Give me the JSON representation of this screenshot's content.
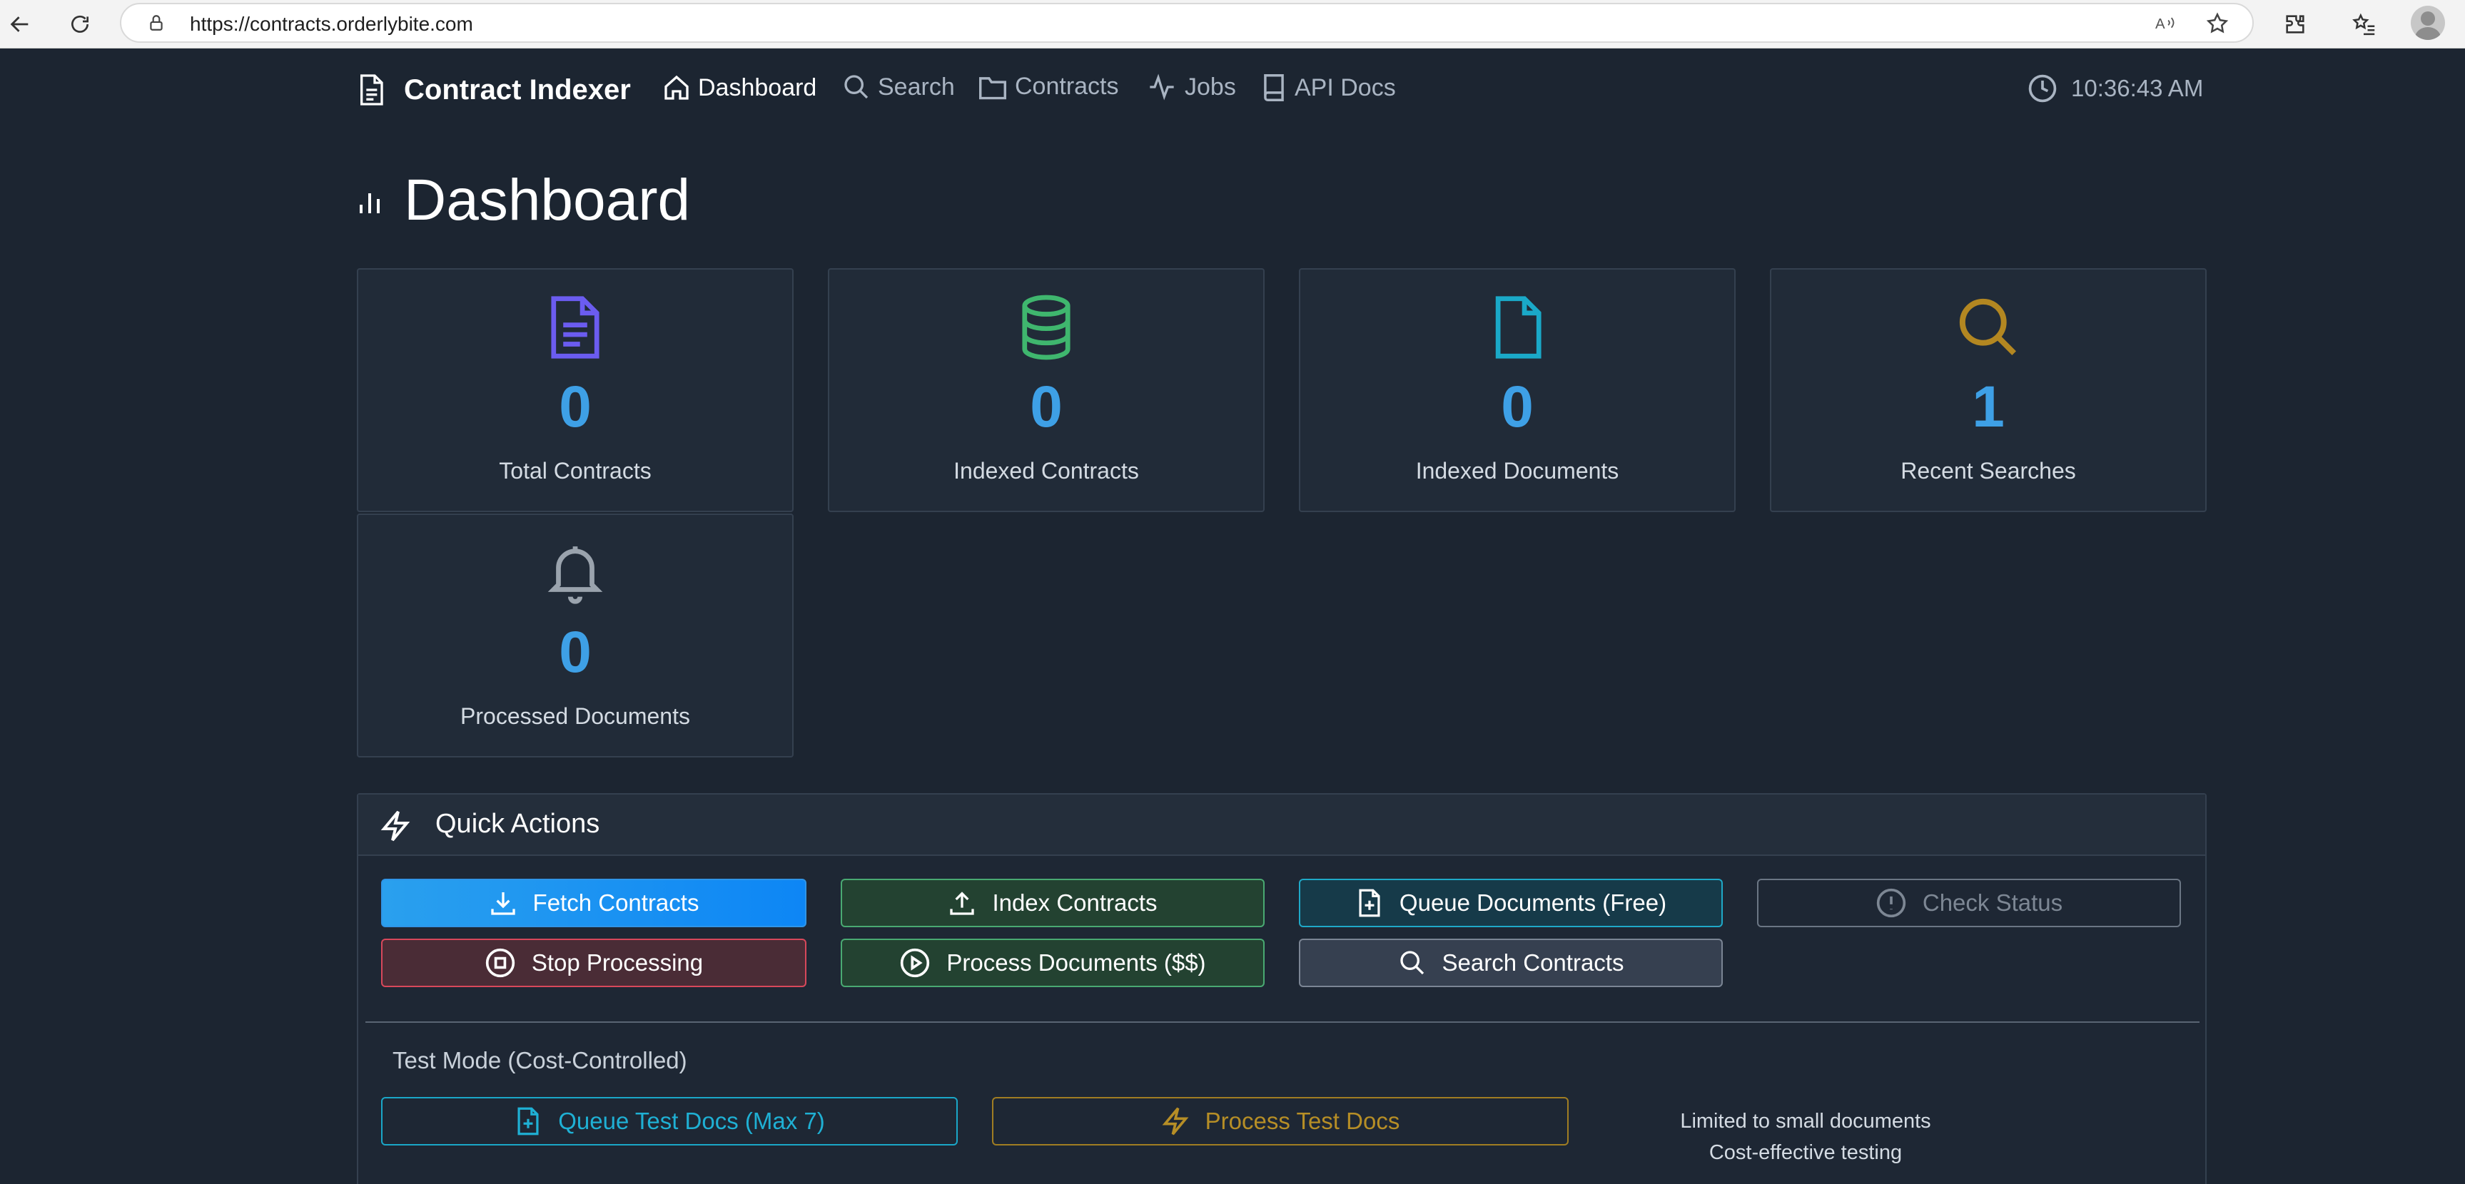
{
  "browser": {
    "url": "https://contracts.orderlybite.com"
  },
  "nav": {
    "brand": "Contract Indexer",
    "items": [
      {
        "label": "Dashboard",
        "icon": "home-icon",
        "active": true
      },
      {
        "label": "Search",
        "icon": "search-icon"
      },
      {
        "label": "Contracts",
        "icon": "folder-icon"
      },
      {
        "label": "Jobs",
        "icon": "activity-icon"
      },
      {
        "label": "API Docs",
        "icon": "book-icon"
      }
    ],
    "time": "10:36:43 AM"
  },
  "page": {
    "title": "Dashboard",
    "title_icon": "bar-chart-icon"
  },
  "stats": [
    {
      "value": "0",
      "label": "Total Contracts",
      "icon": "file-text-icon",
      "color": "#6b5cf0"
    },
    {
      "value": "0",
      "label": "Indexed Contracts",
      "icon": "database-icon",
      "color": "#3fb66e"
    },
    {
      "value": "0",
      "label": "Indexed Documents",
      "icon": "file-icon",
      "color": "#1aa9c8"
    },
    {
      "value": "1",
      "label": "Recent Searches",
      "icon": "search-icon",
      "color": "#b38721"
    },
    {
      "value": "0",
      "label": "Processed Documents",
      "icon": "bell-icon",
      "color": "#9aa3ad"
    }
  ],
  "quick_actions": {
    "title": "Quick Actions",
    "buttons": {
      "fetch": "Fetch Contracts",
      "index": "Index Contracts",
      "queue": "Queue Documents (Free)",
      "check": "Check Status",
      "stop": "Stop Processing",
      "process": "Process Documents ($$)",
      "search": "Search Contracts"
    },
    "test_mode": {
      "title": "Test Mode (Cost-Controlled)",
      "queue_test": "Queue Test Docs (Max 7)",
      "process_test": "Process Test Docs",
      "note_line1": "Limited to small documents",
      "note_line2": "Cost-effective testing"
    }
  }
}
